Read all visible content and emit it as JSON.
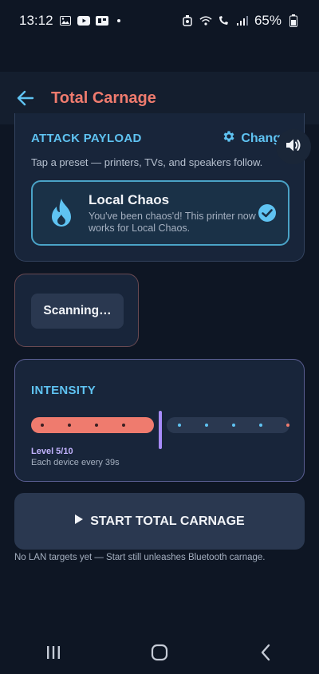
{
  "status_bar": {
    "time": "13:12",
    "battery": "65%",
    "icons": [
      "image-icon",
      "youtube-icon",
      "app-badge-icon",
      "dot-icon",
      "alarm-icon",
      "wifi-icon",
      "call-icon",
      "signal-icon",
      "battery-icon"
    ]
  },
  "appbar": {
    "title": "Total Carnage",
    "title_color": "#ef7b6e",
    "back_icon": "arrow-left-icon"
  },
  "payload": {
    "title": "ATTACK PAYLOAD",
    "change_label": "Change",
    "hint": "Tap a preset — printers, TVs, and speakers follow.",
    "preset": {
      "title": "Local Chaos",
      "description": "You've been chaos'd! This printer now works for Local Chaos.",
      "icon": "flame-icon",
      "selected": true
    }
  },
  "scan": {
    "label": "Scanning…"
  },
  "intensity": {
    "title": "INTENSITY",
    "level": 5,
    "max": 10,
    "level_label": "Level 5/10",
    "subtitle": "Each device every 39s"
  },
  "start": {
    "label": "START TOTAL CARNAGE",
    "icon": "play-icon"
  },
  "footer_note": "No LAN targets yet — Start still unleashes Bluetooth carnage.",
  "colors": {
    "accent": "#5fc3f2",
    "danger": "#ef7b6e",
    "level": "#a78bfa",
    "background": "#0e1624"
  }
}
